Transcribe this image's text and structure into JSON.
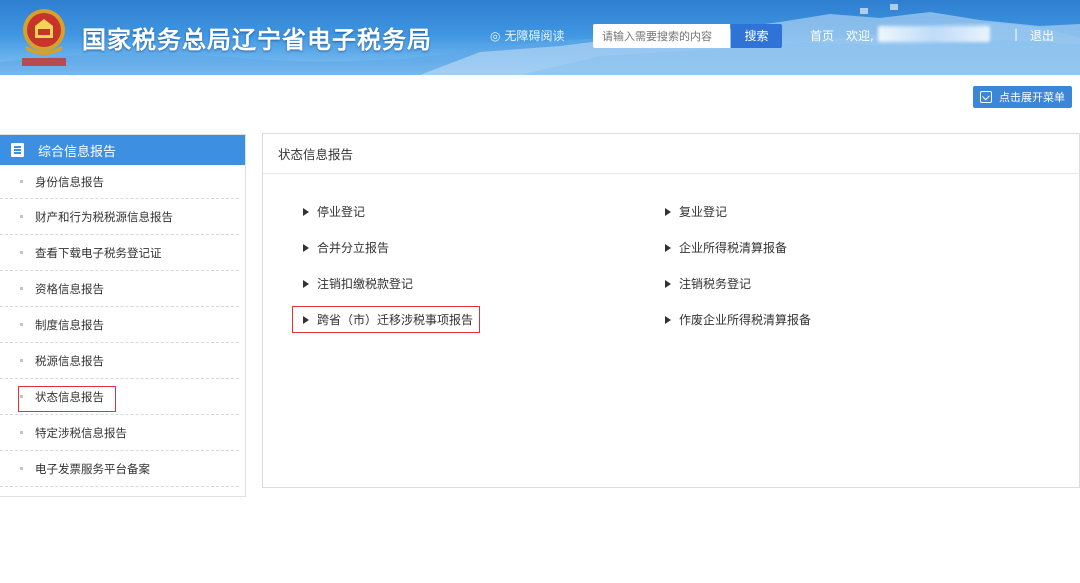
{
  "header": {
    "site_title": "国家税务总局辽宁省电子税务局",
    "accessibility": "无障碍阅读",
    "search_placeholder": "请输入需要搜索的内容",
    "search_button": "搜索",
    "home": "首页",
    "welcome": "欢迎,",
    "separator": "|",
    "logout": "退出"
  },
  "expand_menu": "点击展开菜单",
  "sidebar": {
    "title": "综合信息报告",
    "items": [
      {
        "label": "身份信息报告"
      },
      {
        "label": "财产和行为税税源信息报告"
      },
      {
        "label": "查看下载电子税务登记证"
      },
      {
        "label": "资格信息报告"
      },
      {
        "label": "制度信息报告"
      },
      {
        "label": "税源信息报告"
      },
      {
        "label": "状态信息报告"
      },
      {
        "label": "特定涉税信息报告"
      },
      {
        "label": "电子发票服务平台备案"
      }
    ],
    "selected": "状态信息报告"
  },
  "panel": {
    "title": "状态信息报告",
    "left_links": [
      "停业登记",
      "合并分立报告",
      "注销扣缴税款登记",
      "跨省（市）迁移涉税事项报告"
    ],
    "right_links": [
      "复业登记",
      "企业所得税清算报备",
      "注销税务登记",
      "作废企业所得税清算报备"
    ]
  },
  "colors": {
    "header_blue": "#3f95e0",
    "sidebar_head": "#3d8fe1",
    "highlight_red": "#e0323b",
    "button_blue": "#2f73d6"
  }
}
